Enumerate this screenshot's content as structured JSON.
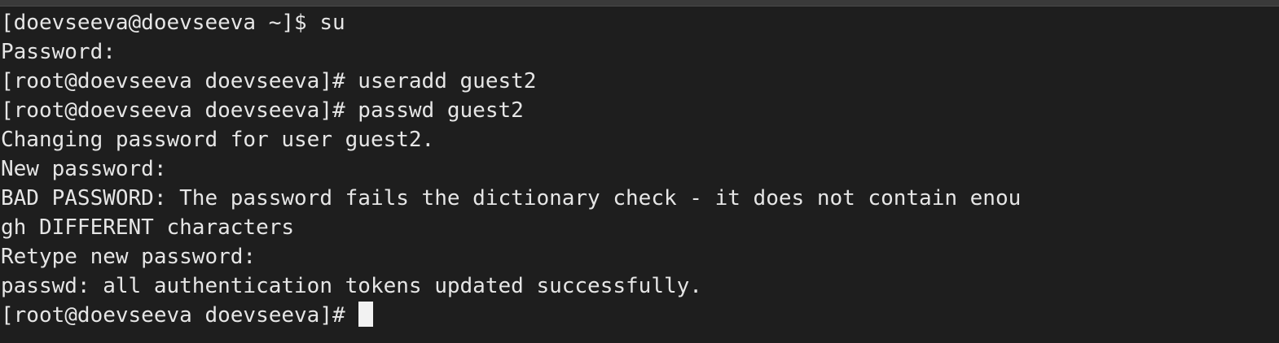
{
  "terminal": {
    "lines": [
      "[doevseeva@doevseeva ~]$ su",
      "Password:",
      "[root@doevseeva doevseeva]# useradd guest2",
      "[root@doevseeva doevseeva]# passwd guest2",
      "Changing password for user guest2.",
      "New password:",
      "BAD PASSWORD: The password fails the dictionary check - it does not contain enou",
      "gh DIFFERENT characters",
      "Retype new password:",
      "passwd: all authentication tokens updated successfully.",
      "[root@doevseeva doevseeva]# "
    ]
  },
  "colors": {
    "background": "#1e1e1e",
    "foreground": "#e6e6e6",
    "cursor": "#f2f2f2"
  }
}
